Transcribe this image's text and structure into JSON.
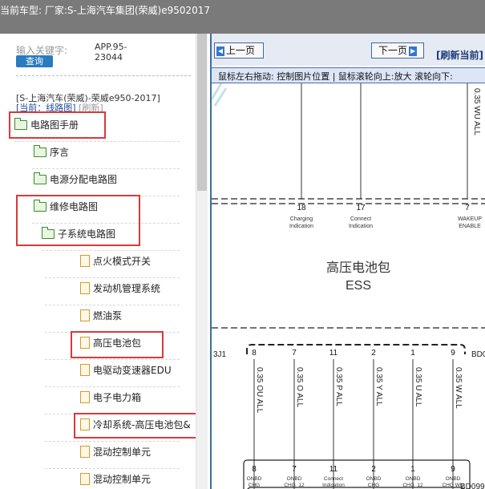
{
  "window": {
    "title": "当前车型:  厂家:S-上海汽车集团(荣威)e9502017"
  },
  "sidebar": {
    "keyword_label": "输入关键字:",
    "keyword_value": "APP.95-\n23044",
    "query_button": "查询",
    "vehicle": "[S-上海汽车(荣威)-荣威e950-2017]",
    "current_prefix": "[当前：",
    "current_link": "线路图",
    "current_refresh": "[刷新]",
    "items": [
      {
        "label": "电路图手册",
        "icon": "folder-icon"
      },
      {
        "label": "序言",
        "icon": "folder-icon"
      },
      {
        "label": "电源分配电路图",
        "icon": "folder-icon"
      },
      {
        "label": "维修电路图",
        "icon": "folder-icon"
      },
      {
        "label": "子系统电路图",
        "icon": "folder-icon"
      },
      {
        "label": "点火模式开关",
        "icon": "document-icon"
      },
      {
        "label": "发动机管理系统",
        "icon": "document-icon"
      },
      {
        "label": "燃油泵",
        "icon": "document-icon"
      },
      {
        "label": "高压电池包",
        "icon": "document-icon"
      },
      {
        "label": "电驱动变速器EDU",
        "icon": "document-icon"
      },
      {
        "label": "电子电力箱",
        "icon": "document-icon"
      },
      {
        "label": "冷却系统-高压电池包&",
        "icon": "document-icon"
      },
      {
        "label": "混动控制单元",
        "icon": "document-icon"
      },
      {
        "label": "混动控制单元",
        "icon": "document-icon"
      }
    ]
  },
  "viewer": {
    "prev_button": "上一页",
    "next_button": "下一页",
    "refresh": "[刷新当前]",
    "hint": "鼠标左右拖动: 控制图片位置 | 鼠标滚轮向上:放大  滚轮向下:"
  },
  "diagram": {
    "top_wires": [
      "0.35 WU ALL"
    ],
    "top_pins": [
      {
        "num": "18",
        "label1": "Charging",
        "label2": "Indication"
      },
      {
        "num": "17",
        "label1": "Connect",
        "label2": "Indication"
      },
      {
        "num": "7",
        "label1": "WAKEUP",
        "label2": "ENABLE"
      }
    ],
    "title_cn": "高压电池包",
    "title_en": "ESS",
    "connector_left": "3J1",
    "connector_right_top": "BD0",
    "connector_right_bottom": "BD099",
    "mid_pins": [
      "8",
      "7",
      "11",
      "2",
      "1",
      "9"
    ],
    "mid_wires": [
      "0.35 OU ALL",
      "0.35 O ALL",
      "0.35 P ALL",
      "0.35 Y ALL",
      "0.35 U ALL",
      "0.35 W ALL"
    ],
    "bottom_pins": [
      "8",
      "7",
      "11",
      "2",
      "1",
      "9"
    ],
    "bottom_labels": [
      {
        "l1": "ONBD",
        "l2": "CHG"
      },
      {
        "l1": "ONBD",
        "l2": "CHG_12"
      },
      {
        "l1": "Connect",
        "l2": "Indication"
      },
      {
        "l1": "ONBD",
        "l2": "CHG"
      },
      {
        "l1": "ONBD",
        "l2": "CHG_12"
      },
      {
        "l1": "ONBD",
        "l2": "CHG WU"
      }
    ]
  }
}
